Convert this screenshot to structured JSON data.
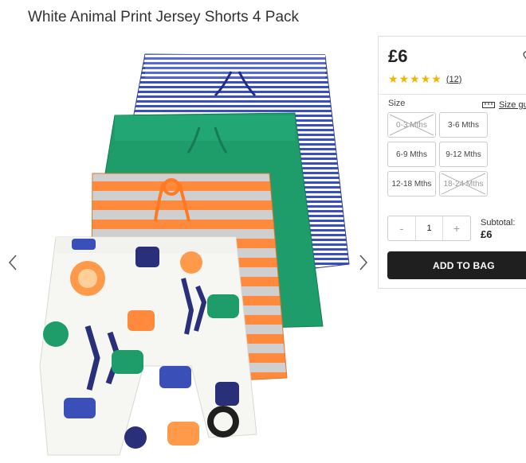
{
  "product": {
    "title": "White Animal Print Jersey Shorts 4 Pack",
    "price": "£6",
    "rating_stars": 5,
    "review_count": "(12)"
  },
  "sizes": {
    "label": "Size",
    "guide_label": "Size gu",
    "options": [
      {
        "label": "0-3 Mths",
        "available": false
      },
      {
        "label": "3-6 Mths",
        "available": true
      },
      {
        "label": "6-9 Mths",
        "available": true
      },
      {
        "label": "9-12 Mths",
        "available": true
      },
      {
        "label": "12-18 Mths",
        "available": true
      },
      {
        "label": "18-24 Mths",
        "available": false
      }
    ]
  },
  "quantity": {
    "minus": "-",
    "value": "1",
    "plus": "+"
  },
  "subtotal": {
    "label": "Subtotal:",
    "value": "£6"
  },
  "cart": {
    "add_label": "ADD TO BAG"
  },
  "icons": {
    "prev": "chevron-left-icon",
    "next": "chevron-right-icon",
    "wishlist": "heart-icon",
    "size_guide": "ruler-icon"
  },
  "colors": {
    "star": "#f5b301",
    "button": "#1f1f1f",
    "stripe_blue": "#3b4fb8",
    "green": "#1e9d6b",
    "orange": "#ff8a3d"
  }
}
